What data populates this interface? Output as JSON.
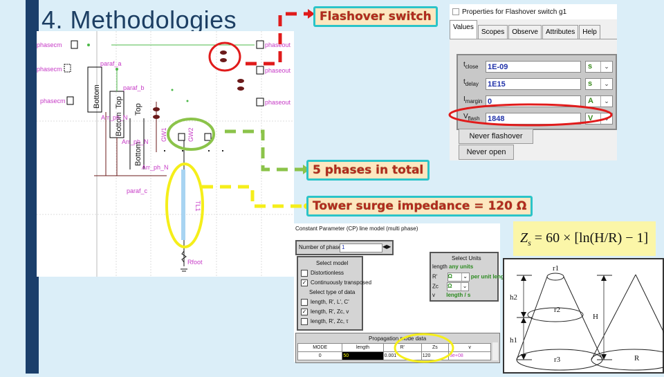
{
  "slide": {
    "title": "4. Methodologies",
    "accent_color": "#1b3f6b",
    "background_color": "#dbeef8"
  },
  "callouts": {
    "flashover": "Flashover switch",
    "phases": "5 phases in total",
    "tower": "Tower surge impedance = 120 Ω"
  },
  "schematic": {
    "labels": {
      "phasecm_left": "phasecm",
      "phasecm_left2": "phasecm",
      "phasecm_left3": "phasecm",
      "phaseout_1": "phaseout",
      "phaseout_2": "phaseout",
      "phaseout_3": "phaseout",
      "paraf_a": "paraf_a",
      "paraf_b": "paraf_b",
      "paraf_c": "paraf_c",
      "arr_ph_n_1": "Arr_ph_N",
      "arr_ph_n_2": "Arr_ph_N",
      "arr_ph_n_3": "Arr_ph_N",
      "gw1": "GW1",
      "gw2": "GW2",
      "tl1": "TL1",
      "rfoot": "Rfoot",
      "top": "Top",
      "bottom": "Bottom"
    }
  },
  "properties_dialog": {
    "title": "Properties for Flashover switch g1",
    "tabs": [
      "Values",
      "Scopes",
      "Observe",
      "Attributes",
      "Help"
    ],
    "active_tab": "Values",
    "fields": [
      {
        "label": "t",
        "sub": "close",
        "value": "1E-09",
        "unit": "s"
      },
      {
        "label": "t",
        "sub": "delay",
        "value": "1E15",
        "unit": "s"
      },
      {
        "label": "I",
        "sub": "margin",
        "value": "0",
        "unit": "A"
      },
      {
        "label": "V",
        "sub": "flash",
        "value": "1848",
        "unit": "V"
      }
    ],
    "buttons": {
      "never_flashover": "Never flashover",
      "never_open": "Never open"
    }
  },
  "cp_dialog": {
    "title": "Constant Parameter (CP) line model (multi phase)",
    "phases_label": "Number of phases",
    "phases_value": "1",
    "select_model": {
      "heading": "Select model",
      "options": [
        {
          "label": "Distortionless",
          "checked": false
        },
        {
          "label": "Continuously transposed",
          "checked": true
        }
      ],
      "data_heading": "Select type of data",
      "data_options": [
        {
          "label": "length, R', L', C'",
          "checked": false
        },
        {
          "label": "length, R', Zc, v",
          "checked": true
        },
        {
          "label": "length, R', Zc, τ",
          "checked": false
        }
      ]
    },
    "select_units": {
      "heading": "Select Units",
      "length_label": "length",
      "length_value": "any units",
      "r_label": "R'",
      "r_unit": "Ω",
      "r_note": "per unit length",
      "z_label": "Zc",
      "z_unit": "Ω",
      "v_label": "v",
      "v_note": "length / s"
    },
    "propagation": {
      "heading": "Propagation mode data",
      "columns": [
        "MODE",
        "length",
        "R'",
        "Zs",
        "v"
      ],
      "rows": [
        [
          "0",
          "50",
          "0.001",
          "120",
          "3e+08"
        ]
      ]
    }
  },
  "formula": {
    "lhs": "Z",
    "lhs_sub": "s",
    "rhs": "= 60 × [ln(H/R) − 1]"
  },
  "cone_diagram": {
    "labels": [
      "r1",
      "r2",
      "r3",
      "h2",
      "h1",
      "H",
      "R"
    ]
  }
}
